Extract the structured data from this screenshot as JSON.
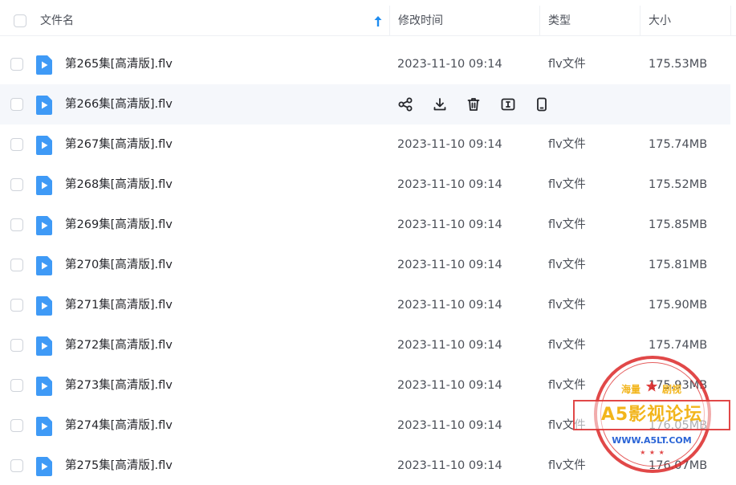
{
  "header": {
    "name_label": "文件名",
    "time_label": "修改时间",
    "type_label": "类型",
    "size_label": "大小"
  },
  "rows": [
    {
      "name": "第265集[高清版].flv",
      "time": "2023-11-10 09:14",
      "type": "flv文件",
      "size": "175.53MB"
    },
    {
      "name": "第266集[高清版].flv",
      "time": "",
      "type": "",
      "size": ""
    },
    {
      "name": "第267集[高清版].flv",
      "time": "2023-11-10 09:14",
      "type": "flv文件",
      "size": "175.74MB"
    },
    {
      "name": "第268集[高清版].flv",
      "time": "2023-11-10 09:14",
      "type": "flv文件",
      "size": "175.52MB"
    },
    {
      "name": "第269集[高清版].flv",
      "time": "2023-11-10 09:14",
      "type": "flv文件",
      "size": "175.85MB"
    },
    {
      "name": "第270集[高清版].flv",
      "time": "2023-11-10 09:14",
      "type": "flv文件",
      "size": "175.81MB"
    },
    {
      "name": "第271集[高清版].flv",
      "time": "2023-11-10 09:14",
      "type": "flv文件",
      "size": "175.90MB"
    },
    {
      "name": "第272集[高清版].flv",
      "time": "2023-11-10 09:14",
      "type": "flv文件",
      "size": "175.74MB"
    },
    {
      "name": "第273集[高清版].flv",
      "time": "2023-11-10 09:14",
      "type": "flv文件",
      "size": "175.93MB"
    },
    {
      "name": "第274集[高清版].flv",
      "time": "2023-11-10 09:14",
      "type": "flv文件",
      "size": "176.05MB"
    },
    {
      "name": "第275集[高清版].flv",
      "time": "2023-11-10 09:14",
      "type": "flv文件",
      "size": "176.07MB"
    }
  ],
  "hover_actions": [
    "share-icon",
    "download-icon",
    "delete-icon",
    "rename-icon",
    "phone-icon"
  ],
  "watermark": {
    "left_text": "海量",
    "right_text": "剧视",
    "banner": "A5影视论坛",
    "url": "WWW.A5LT.COM"
  },
  "colors": {
    "accent": "#1e8cf0",
    "file_icon": "#3f9af6",
    "hover_row": "#f5f7fb",
    "stamp_red": "#dc2828",
    "stamp_gold": "#f2b51c"
  }
}
